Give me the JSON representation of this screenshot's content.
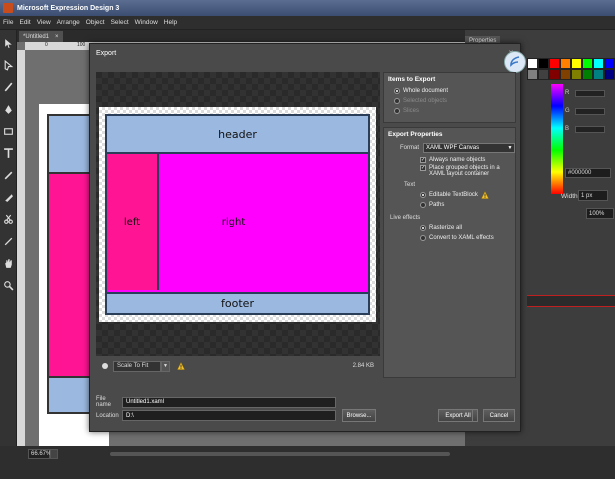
{
  "window": {
    "title": "Microsoft Expression Design 3"
  },
  "menu": [
    "File",
    "Edit",
    "View",
    "Arrange",
    "Object",
    "Select",
    "Window",
    "Help"
  ],
  "document": {
    "tab_label": "*Untitled1",
    "close_glyph": "×"
  },
  "ruler": {
    "mark_0": "0",
    "mark_100": "100"
  },
  "panel": {
    "tab": "Properties",
    "hex_value": "#000000",
    "width_label": "Width",
    "width_value": "1 px",
    "opacity_value": "100%",
    "rgb_labels": [
      "R",
      "G",
      "B"
    ]
  },
  "swatch_colors": [
    "#ffffff",
    "#000000",
    "#ff0000",
    "#ff8000",
    "#ffff00",
    "#00ff00",
    "#00ffff",
    "#0000ff",
    "#808080",
    "#404040",
    "#800000",
    "#804000",
    "#808000",
    "#008000",
    "#008080",
    "#000080"
  ],
  "status": {
    "zoom": "66.67%"
  },
  "dialog": {
    "title": "Export",
    "close": "×",
    "preview": {
      "header": "header",
      "left": "left",
      "right": "right",
      "footer": "footer"
    },
    "scale_option": "Scale To Fit",
    "file_size": "2.84 KB",
    "items_section": {
      "title": "Items to Export",
      "options": [
        {
          "label": "Whole document",
          "selected": true,
          "enabled": true
        },
        {
          "label": "Selected objects",
          "selected": false,
          "enabled": false
        },
        {
          "label": "Slices",
          "selected": false,
          "enabled": false
        }
      ]
    },
    "properties_section": {
      "title": "Export Properties",
      "format_label": "Format",
      "format_value": "XAML WPF Canvas",
      "always_name": "Always name objects",
      "place_grouped": "Place grouped objects in a XAML layout container",
      "text_label": "Text",
      "text_editable": "Editable TextBlock",
      "text_paths": "Paths",
      "live_effects_label": "Live effects",
      "rasterize_all": "Rasterize all",
      "convert_xaml": "Convert to XAML effects"
    },
    "file_name_label": "File name",
    "file_name_value": "Untitled1.xaml",
    "location_label": "Location",
    "location_value": "D:\\",
    "browse_button": "Browse...",
    "export_button": "Export All",
    "cancel_button": "Cancel"
  }
}
